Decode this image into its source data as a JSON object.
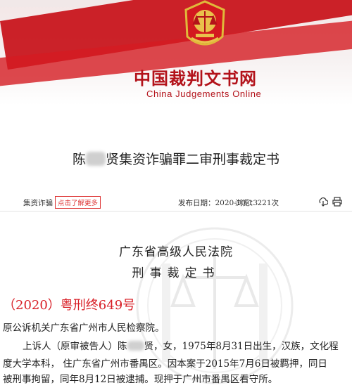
{
  "site": {
    "title_cn": "中国裁判文书网",
    "title_en": "China Judgements Online"
  },
  "document": {
    "title_prefix": "陈",
    "title_suffix": "贤集资诈骗罪二审刑事裁定书",
    "category_tag": "集资诈骗",
    "more_label": "点击了解更多",
    "publish_date": "发布日期：2020-10-13",
    "views": "浏览：221次",
    "court_name": "广东省高级人民法院",
    "doc_type": "刑事裁定书",
    "case_number": "（2020）粤刑终649号",
    "paragraphs": {
      "line1": "原公诉机关广东省广州市人民检察院。",
      "line2a": "上诉人（原审被告人）陈",
      "line2b": "贤，女，1975年8月31日出生，汉族，文化程",
      "line3": "度大学本科，    住广东省广州市番禺区。因本案于2015年7月6日被羁押，同日",
      "line4": "被刑事拘留，同年8月12日被逮捕。现押于广州市番禺区看守所。"
    }
  },
  "icons": {
    "emblem": "court-emblem-icon",
    "download": "download-icon",
    "print": "print-icon"
  },
  "colors": {
    "brand_red": "#c8161d",
    "case_red": "#d81e26"
  }
}
